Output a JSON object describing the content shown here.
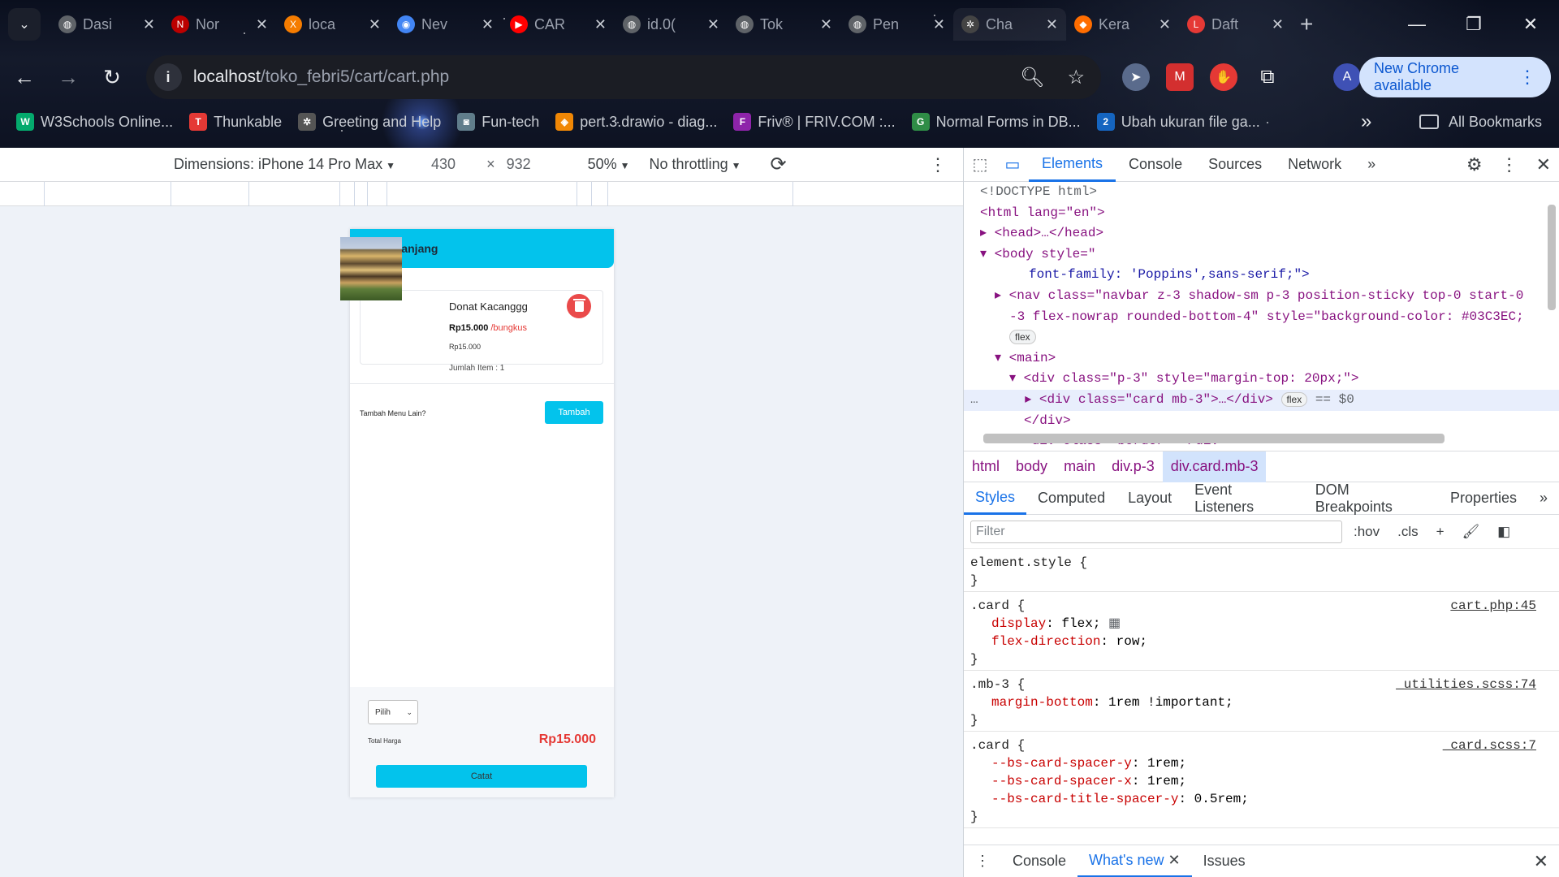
{
  "colors": {
    "accent": "#03C3EC",
    "danger": "#e53935",
    "devtools_blue": "#1a73e8"
  },
  "browser": {
    "tabs": [
      {
        "label": "Dasi",
        "icon": "globe-icon",
        "active": false
      },
      {
        "label": "Nor",
        "icon": "netflix-icon",
        "active": false
      },
      {
        "label": "loca",
        "icon": "xampp-icon",
        "active": false
      },
      {
        "label": "Nev",
        "icon": "chrome-icon",
        "active": false
      },
      {
        "label": "CAR",
        "icon": "youtube-icon",
        "active": false
      },
      {
        "label": "id.0(",
        "icon": "globe-icon",
        "active": false
      },
      {
        "label": "Tok",
        "icon": "globe-icon",
        "active": false
      },
      {
        "label": "Pen",
        "icon": "globe-icon",
        "active": false
      },
      {
        "label": "Cha",
        "icon": "openai-icon",
        "active": true
      },
      {
        "label": "Kera",
        "icon": "app-icon",
        "active": false
      },
      {
        "label": "Daft",
        "icon": "laragon-icon",
        "active": false
      }
    ],
    "url_host": "localhost",
    "url_path": "/toko_febri5/cart/cart.php",
    "avatar_letter": "A",
    "new_chrome_label": "New Chrome available",
    "bookmarks": [
      {
        "label": "W3Schools Online...",
        "icon": "w3schools-icon"
      },
      {
        "label": "Thunkable",
        "icon": "thunkable-icon"
      },
      {
        "label": "Greeting and Help",
        "icon": "openai-icon"
      },
      {
        "label": "Fun-tech",
        "icon": "robot-icon"
      },
      {
        "label": "pert.3.drawio - diag...",
        "icon": "drawio-icon"
      },
      {
        "label": "Friv® | FRIV.COM :...",
        "icon": "friv-icon"
      },
      {
        "label": "Normal Forms in DB...",
        "icon": "gfg-icon"
      },
      {
        "label": "Ubah ukuran file ga...",
        "icon": "doc-icon"
      }
    ],
    "all_bookmarks_label": "All Bookmarks"
  },
  "emulation": {
    "dimensions_label": "Dimensions: iPhone 14 Pro Max",
    "width": "430",
    "times": "×",
    "height": "932",
    "zoom": "50%",
    "throttling": "No throttling"
  },
  "page": {
    "nav_title": "Keranjang",
    "item": {
      "name": "Donat Kacanggg",
      "price": "Rp15.000",
      "unit": "/bungkus",
      "subtotal": "Rp15.000",
      "qty_label": "Jumlah Item : 1"
    },
    "add_label": "Tambah Menu Lain?",
    "add_button": "Tambah",
    "select_value": "Pilih",
    "total_label": "Total Harga",
    "total_value": "Rp15.000",
    "submit_button": "Catat"
  },
  "devtools": {
    "tabs": [
      "Elements",
      "Console",
      "Sources",
      "Network"
    ],
    "dom_lines": [
      "<!DOCTYPE html>",
      "<html lang=\"en\">",
      "<head>…</head>",
      "<body style=\"",
      "font-family: 'Poppins',sans-serif;\">",
      "<nav class=\"navbar z-3 shadow-sm p-3 position-sticky top-0 start-0",
      "-3 flex-nowrap rounded-bottom-4\" style=\"background-color: #03C3EC;",
      "flex",
      "<main>",
      "<div class=\"p-3\" style=\"margin-top: 20px;\">",
      "<div class=\"card mb-3\">…</div>",
      "== $0",
      "</div>",
      "<div class=\"border\"></div>"
    ],
    "breadcrumbs": [
      "html",
      "body",
      "main",
      "div.p-3",
      "div.card.mb-3"
    ],
    "style_tabs": [
      "Styles",
      "Computed",
      "Layout",
      "Event Listeners",
      "DOM Breakpoints",
      "Properties"
    ],
    "filter_placeholder": "Filter",
    "hov": ":hov",
    "cls": ".cls",
    "rules": [
      {
        "selector": "element.style {",
        "source": "",
        "props": []
      },
      {
        "selector": ".card {",
        "source": "cart.php:45",
        "props": [
          [
            "display",
            "flex;"
          ],
          [
            "flex-direction",
            "row;"
          ]
        ]
      },
      {
        "selector": ".mb-3 {",
        "source": "_utilities.scss:74",
        "props": [
          [
            "margin-bottom",
            "1rem !important;"
          ]
        ]
      },
      {
        "selector": ".card {",
        "source": "_card.scss:7",
        "props": [
          [
            "--bs-card-spacer-y",
            "1rem;"
          ],
          [
            "--bs-card-spacer-x",
            "1rem;"
          ],
          [
            "--bs-card-title-spacer-y",
            "0.5rem;"
          ]
        ]
      }
    ],
    "drawer_tabs": [
      "Console",
      "What's new",
      "Issues"
    ]
  }
}
